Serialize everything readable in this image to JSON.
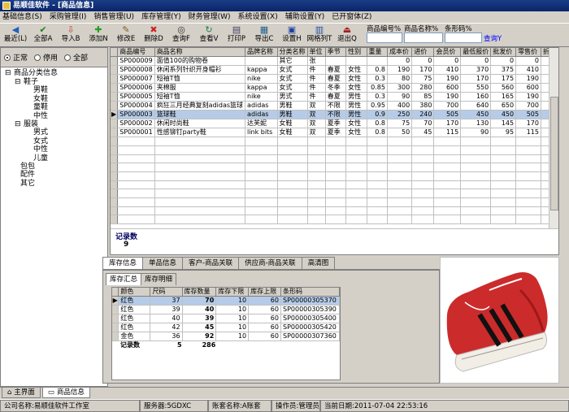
{
  "window": {
    "title": "易顺佳软件 - [商品信息]"
  },
  "menu": [
    "基础信息(S)",
    "采购管理(I)",
    "销售管理(U)",
    "库存管理(Y)",
    "财务管理(W)",
    "系统设置(X)",
    "辅助设置(Y)",
    "已开窗体(Z)"
  ],
  "toolbar": [
    {
      "label": "最近(L)",
      "icon": "back-arrow-icon",
      "glyph": "◀",
      "color": "#2060c0"
    },
    {
      "label": "全部A",
      "icon": "check-icon",
      "glyph": "✔",
      "color": "#208020"
    },
    {
      "label": "导入B",
      "icon": "import-icon",
      "glyph": "⇩",
      "color": "#c04020"
    },
    {
      "label": "添加N",
      "icon": "add-icon",
      "glyph": "✚",
      "color": "#20a020"
    },
    {
      "label": "修改E",
      "icon": "edit-icon",
      "glyph": "✎",
      "color": "#806020"
    },
    {
      "label": "删除D",
      "icon": "delete-icon",
      "glyph": "✖",
      "color": "#d02020"
    },
    {
      "label": "查询F",
      "icon": "binoculars-icon",
      "glyph": "◎",
      "color": "#303030"
    },
    {
      "label": "查看V",
      "icon": "refresh-icon",
      "glyph": "↻",
      "color": "#208040"
    },
    {
      "label": "打印P",
      "icon": "printer-icon",
      "glyph": "▤",
      "color": "#404060"
    },
    {
      "label": "导出C",
      "icon": "export-icon",
      "glyph": "▦",
      "color": "#206090"
    },
    {
      "label": "设置H",
      "icon": "settings-icon",
      "glyph": "▣",
      "color": "#2040a0"
    },
    {
      "label": "网格列T",
      "icon": "grid-columns-icon",
      "glyph": "▥",
      "color": "#2050a0"
    },
    {
      "label": "退出Q",
      "icon": "exit-icon",
      "glyph": "⏏",
      "color": "#a02020"
    }
  ],
  "search": {
    "code_label": "商品编号%",
    "name_label": "商品名称%",
    "barcode_label": "条形码%",
    "query_label": "查询Y"
  },
  "filter": {
    "options": [
      "正常",
      "停用",
      "全部"
    ],
    "selected": "正常"
  },
  "tree": {
    "root": "商品分类信息",
    "nodes": [
      {
        "label": "鞋子",
        "level": 1
      },
      {
        "label": "男鞋",
        "level": 2
      },
      {
        "label": "女鞋",
        "level": 2
      },
      {
        "label": "童鞋",
        "level": 2
      },
      {
        "label": "中性",
        "level": 2
      },
      {
        "label": "服装",
        "level": 1
      },
      {
        "label": "男式",
        "level": 2
      },
      {
        "label": "女式",
        "level": 2
      },
      {
        "label": "中性",
        "level": 2
      },
      {
        "label": "儿童",
        "level": 2
      },
      {
        "label": "包包",
        "level": 1
      },
      {
        "label": "配件",
        "level": 1
      },
      {
        "label": "其它",
        "level": 1
      }
    ]
  },
  "product_grid": {
    "columns": [
      "商品编号",
      "商品名称",
      "品牌名称",
      "分类名称",
      "单位",
      "季节",
      "性别",
      "重量",
      "成本价",
      "进价",
      "会员价",
      "最低报价",
      "批发价",
      "零售价",
      "折扣"
    ],
    "rows": [
      [
        "SP000009",
        "面值100的购物卷",
        "",
        "其它",
        "张",
        "",
        "",
        "",
        "0",
        "0",
        "0",
        "0",
        "0",
        "0",
        ""
      ],
      [
        "SP000008",
        "休闲系列针织开身帽衫",
        "kappa",
        "女式",
        "件",
        "春夏",
        "女性",
        "0.8",
        "190",
        "170",
        "410",
        "370",
        "375",
        "410",
        ""
      ],
      [
        "SP000007",
        "短袖T恤",
        "nike",
        "女式",
        "件",
        "春夏",
        "女性",
        "0.3",
        "80",
        "75",
        "190",
        "170",
        "175",
        "190",
        ""
      ],
      [
        "SP000006",
        "夹棉服",
        "kappa",
        "女式",
        "件",
        "冬季",
        "女性",
        "0.85",
        "300",
        "280",
        "600",
        "550",
        "560",
        "600",
        ""
      ],
      [
        "SP000005",
        "短袖T恤",
        "nike",
        "男式",
        "件",
        "春夏",
        "男性",
        "0.3",
        "90",
        "85",
        "190",
        "160",
        "165",
        "190",
        ""
      ],
      [
        "SP000004",
        "疯狂三月经典复刻adidas篮球",
        "adidas",
        "男鞋",
        "双",
        "不限",
        "男性",
        "0.95",
        "400",
        "380",
        "700",
        "640",
        "650",
        "700",
        ""
      ],
      [
        "SP000003",
        "篮球鞋",
        "adidas",
        "男鞋",
        "双",
        "不限",
        "男性",
        "0.9",
        "250",
        "240",
        "505",
        "450",
        "450",
        "505",
        ""
      ],
      [
        "SP000002",
        "休闲时尚鞋",
        "达芙妮",
        "女鞋",
        "双",
        "夏季",
        "女性",
        "0.8",
        "75",
        "70",
        "170",
        "130",
        "145",
        "170",
        ""
      ],
      [
        "SP000001",
        "性感铆钉party鞋",
        "link bits",
        "女鞋",
        "双",
        "夏季",
        "女性",
        "0.8",
        "50",
        "45",
        "115",
        "90",
        "95",
        "115",
        ""
      ]
    ],
    "selected_index": 6,
    "record_label": "记录数",
    "record_count": "9"
  },
  "detail_tabs": [
    "库存信息",
    "单品信息",
    "客户-商品关联",
    "供应商-商品关联",
    "高清图"
  ],
  "stock_subtabs": [
    "库存汇总",
    "库存明细"
  ],
  "stock_grid": {
    "columns": [
      "颜色",
      "尺码",
      "库存数量",
      "库存下限",
      "库存上限",
      "条形码"
    ],
    "rows": [
      [
        "红色",
        "37",
        "70",
        "10",
        "60",
        "SP00000305370"
      ],
      [
        "红色",
        "39",
        "40",
        "10",
        "60",
        "SP00000305390"
      ],
      [
        "红色",
        "40",
        "39",
        "10",
        "60",
        "SP00000305400"
      ],
      [
        "红色",
        "42",
        "45",
        "10",
        "60",
        "SP00000305420"
      ],
      [
        "金色",
        "36",
        "92",
        "10",
        "60",
        "SP00000307360"
      ]
    ],
    "sum_label": "记录数",
    "sum_count": "5",
    "sum_qty": "286"
  },
  "bottom_tabs": [
    "主界面",
    "商品信息"
  ],
  "status": {
    "company": "公司名称:易顺佳软件工作室",
    "server": "服务器:5GDXC",
    "account": "账套名称:A账套",
    "operator": "操作员:管理员",
    "date": "当前日期:2011-07-04 22:53:16"
  }
}
